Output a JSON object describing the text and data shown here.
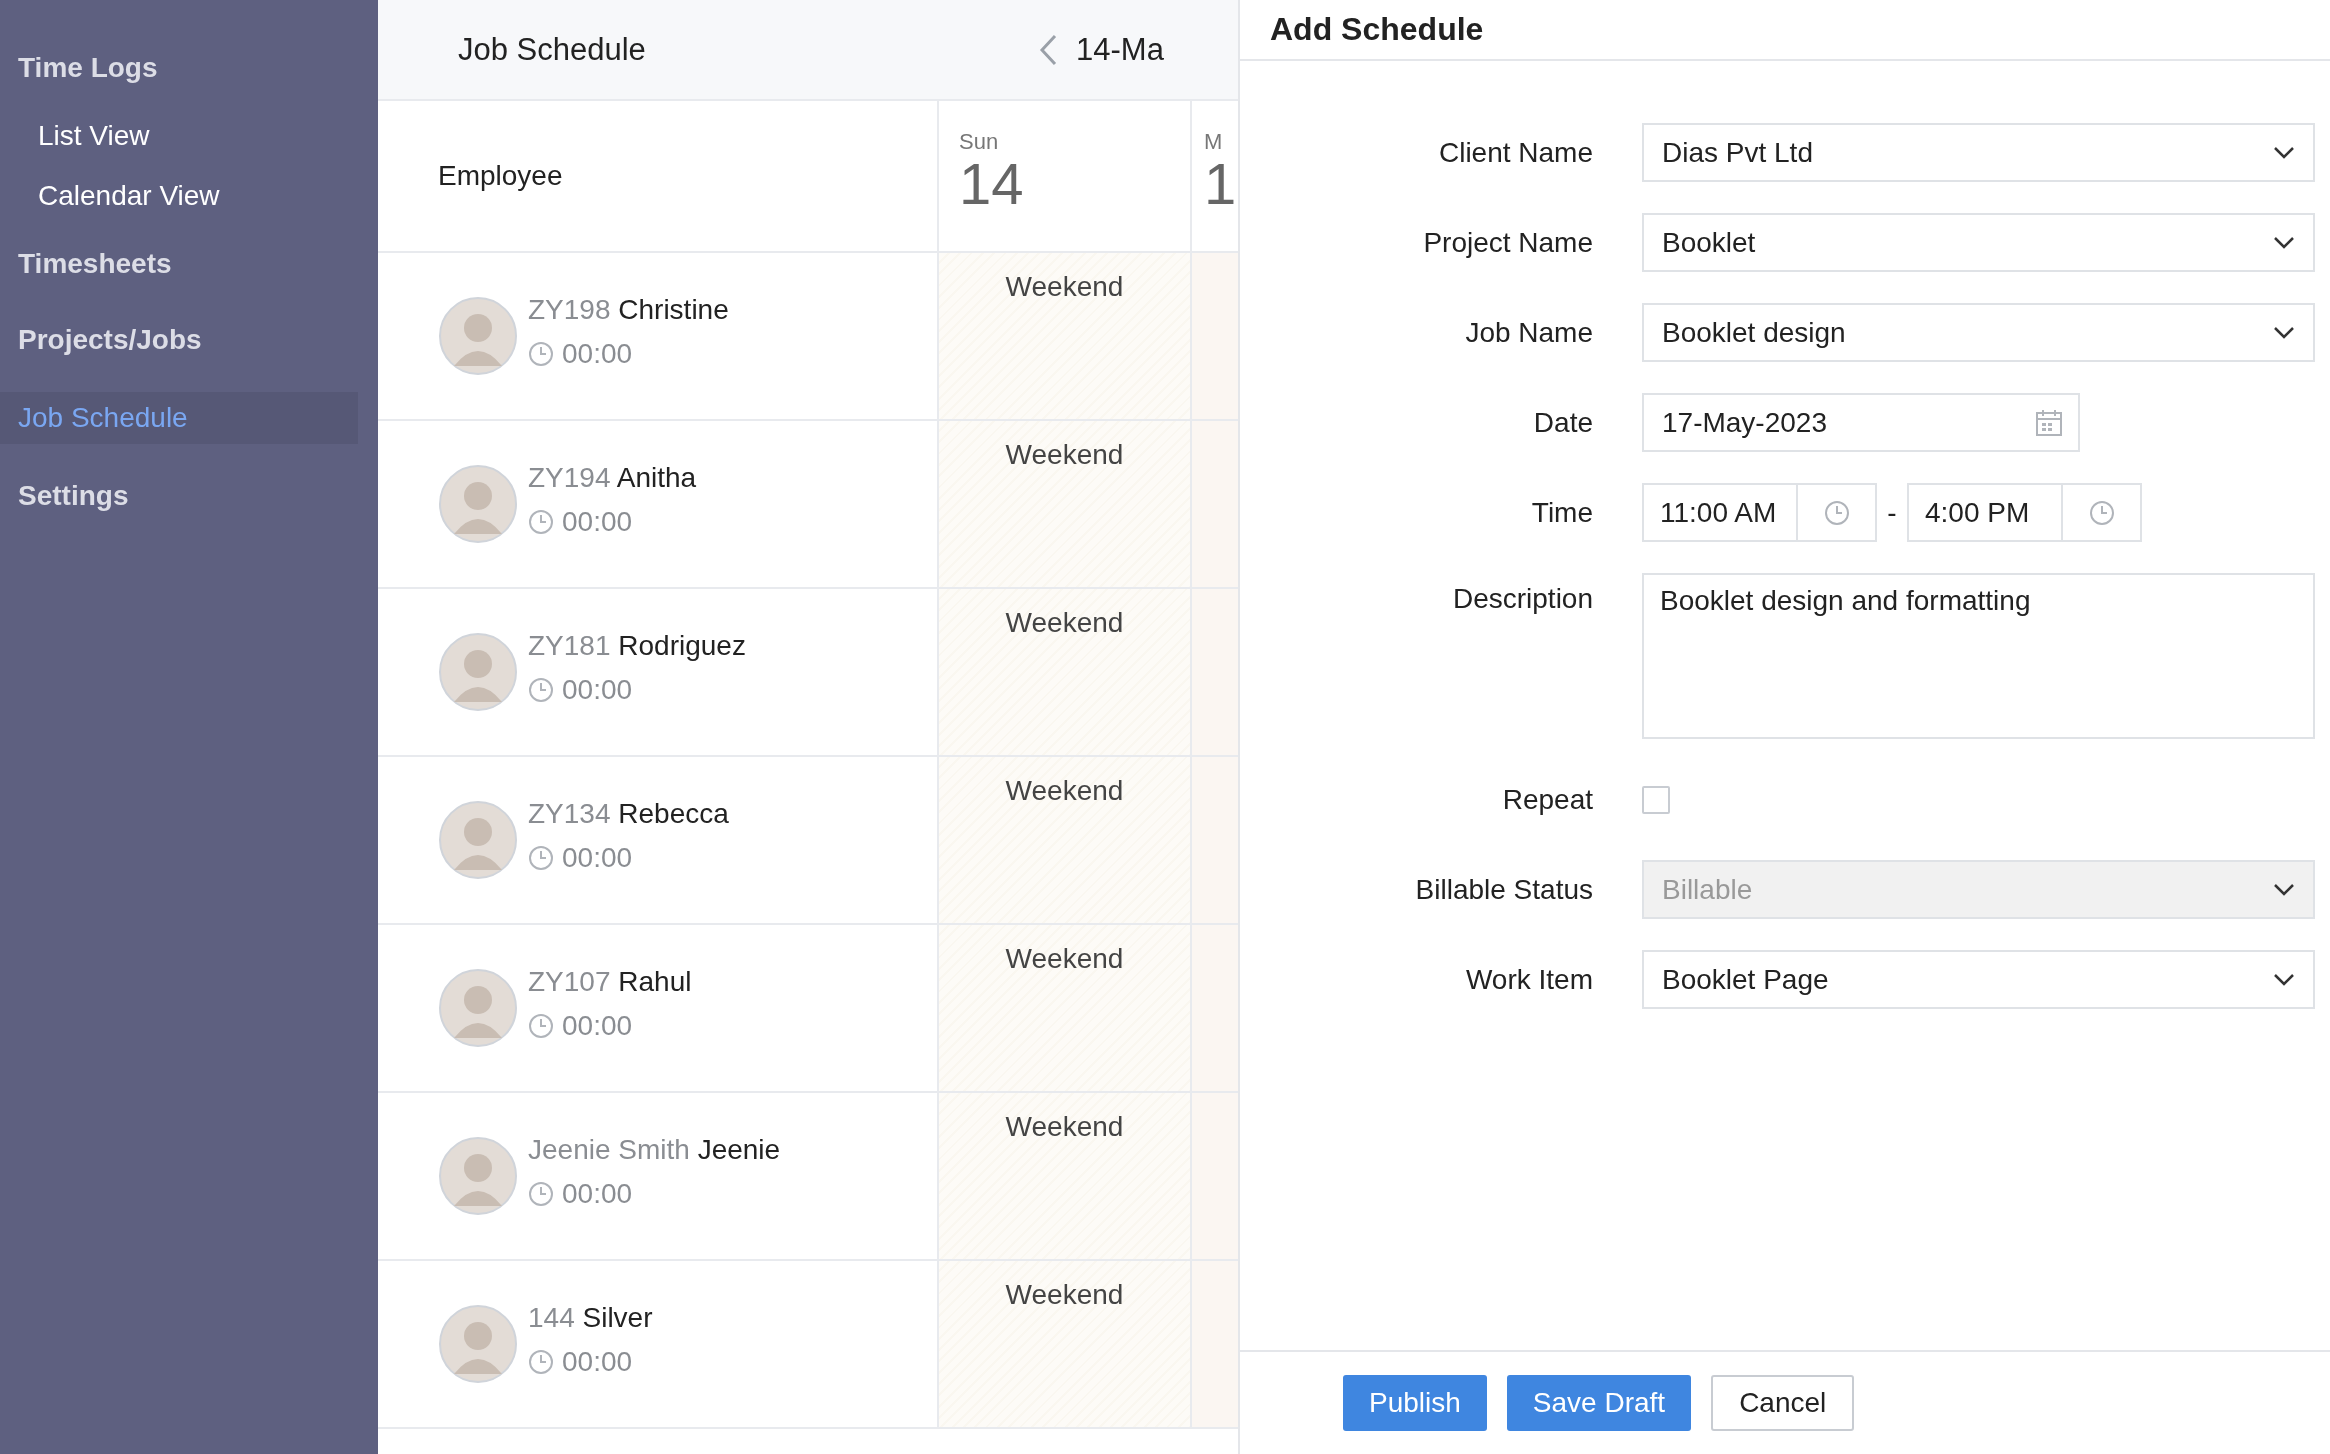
{
  "sidebar": {
    "items": [
      {
        "label": "Time Logs",
        "selected": false,
        "children": [
          {
            "label": "List View",
            "selected": false
          },
          {
            "label": "Calendar View",
            "selected": false
          }
        ]
      },
      {
        "label": "Timesheets",
        "selected": false
      },
      {
        "label": "Projects/Jobs",
        "selected": false
      },
      {
        "label": "Job Schedule",
        "selected": true
      },
      {
        "label": "Settings",
        "selected": false
      }
    ]
  },
  "schedule": {
    "title": "Job Schedule",
    "range": "14-Ma",
    "employee_header": "Employee",
    "days": [
      {
        "day": "Sun",
        "date": "14"
      },
      {
        "day": "M",
        "date": "1"
      }
    ],
    "rows": [
      {
        "code": "ZY198",
        "name": "Christine",
        "hours": "00:00",
        "cells": [
          "Weekend"
        ]
      },
      {
        "code": "ZY194",
        "name": "Anitha",
        "hours": "00:00",
        "cells": [
          "Weekend"
        ]
      },
      {
        "code": "ZY181",
        "name": "Rodriguez",
        "hours": "00:00",
        "cells": [
          "Weekend"
        ]
      },
      {
        "code": "ZY134",
        "name": "Rebecca",
        "hours": "00:00",
        "cells": [
          "Weekend"
        ]
      },
      {
        "code": "ZY107",
        "name": "Rahul",
        "hours": "00:00",
        "cells": [
          "Weekend"
        ]
      },
      {
        "code": "Jeenie Smith",
        "name": "Jeenie",
        "hours": "00:00",
        "cells": [
          "Weekend"
        ]
      },
      {
        "code": "144",
        "name": "Silver",
        "hours": "00:00",
        "cells": [
          "Weekend"
        ]
      }
    ]
  },
  "drawer": {
    "title": "Add Schedule",
    "fields": [
      {
        "label": "Client Name",
        "kind": "select",
        "value": "Dias Pvt Ltd",
        "disabled": false
      },
      {
        "label": "Project Name",
        "kind": "select",
        "value": "Booklet",
        "disabled": false
      },
      {
        "label": "Job Name",
        "kind": "select",
        "value": "Booklet design",
        "disabled": false
      },
      {
        "label": "Date",
        "kind": "date",
        "value": "17-May-2023"
      },
      {
        "label": "Time",
        "kind": "time",
        "start": "11:00 AM",
        "separator": "-",
        "end": "4:00 PM"
      },
      {
        "label": "Description",
        "kind": "textarea",
        "value": "Booklet design and formatting"
      },
      {
        "label": "Repeat",
        "kind": "checkbox",
        "checked": false
      },
      {
        "label": "Billable Status",
        "kind": "select",
        "value": "Billable",
        "disabled": true
      },
      {
        "label": "Work Item",
        "kind": "select",
        "value": "Booklet Page",
        "disabled": false
      }
    ],
    "buttons": [
      {
        "label": "Publish",
        "kind": "primary"
      },
      {
        "label": "Save Draft",
        "kind": "primary"
      },
      {
        "label": "Cancel",
        "kind": "secondary"
      }
    ]
  }
}
